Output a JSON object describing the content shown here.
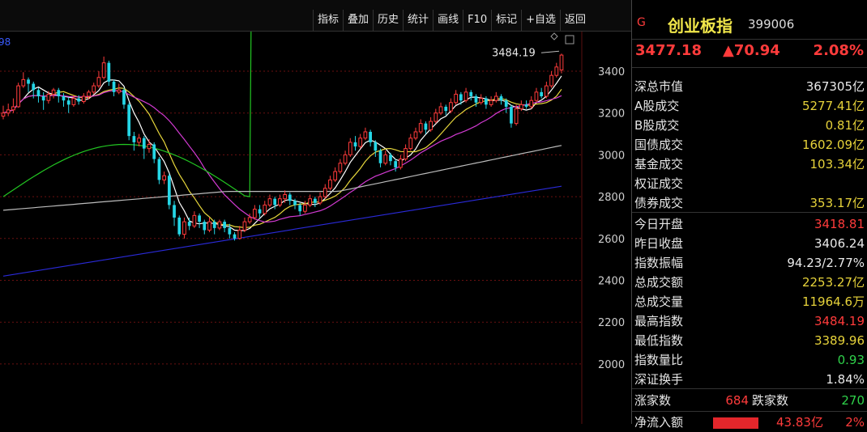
{
  "toolbar": [
    "指标",
    "叠加",
    "历史",
    "统计",
    "画线",
    "F10",
    "标记",
    "+自选",
    "返回"
  ],
  "chart": {
    "ylabels": [
      "3400",
      "3200",
      "3000",
      "2800",
      "2600",
      "2400",
      "2200",
      "2000"
    ],
    "high_label": "3484.19",
    "left_fragment": "98"
  },
  "colors": {
    "up": "#ff3b3b",
    "down": "#25d6e6",
    "ma5": "#ffffff",
    "ma10": "#e8d83c",
    "ma20": "#d23ad2",
    "ma60": "#22c622",
    "ma120": "#bcbcbc",
    "ma250": "#2a2ad8"
  },
  "panel": {
    "market_icon": "G",
    "name": "创业板指",
    "code": "399006",
    "price": "3477.18",
    "change": "▲70.94",
    "pct": "2.08%",
    "rows": [
      {
        "label": "深总市值",
        "value": "367305亿",
        "color": "white"
      },
      {
        "label": "A股成交",
        "value": "5277.41亿",
        "color": "yellow"
      },
      {
        "label": "B股成交",
        "value": "0.81亿",
        "color": "yellow"
      },
      {
        "label": "国债成交",
        "value": "1602.09亿",
        "color": "yellow"
      },
      {
        "label": "基金成交",
        "value": "103.34亿",
        "color": "yellow"
      },
      {
        "label": "权证成交",
        "value": "",
        "color": "yellow"
      },
      {
        "label": "债券成交",
        "value": "353.17亿",
        "color": "yellow"
      },
      {
        "label": "今日开盘",
        "value": "3418.81",
        "color": "red"
      },
      {
        "label": "昨日收盘",
        "value": "3406.24",
        "color": "white"
      },
      {
        "label": "指数振幅",
        "value": "94.23/2.77%",
        "color": "white"
      },
      {
        "label": "总成交额",
        "value": "2253.27亿",
        "color": "yellow"
      },
      {
        "label": "总成交量",
        "value": "11964.6万",
        "color": "yellow"
      },
      {
        "label": "最高指数",
        "value": "3484.19",
        "color": "red"
      },
      {
        "label": "最低指数",
        "value": "3389.96",
        "color": "yellow"
      },
      {
        "label": "指数量比",
        "value": "0.93",
        "color": "green"
      },
      {
        "label": "深证换手",
        "value": "1.84%",
        "color": "white"
      }
    ],
    "advance_label": "涨家数",
    "advance_value": "684",
    "decline_label": "跌家数",
    "decline_value": "270",
    "bottom_label": "净流入额",
    "bottom_value": "43.83亿",
    "bottom_pct": "2%"
  }
}
